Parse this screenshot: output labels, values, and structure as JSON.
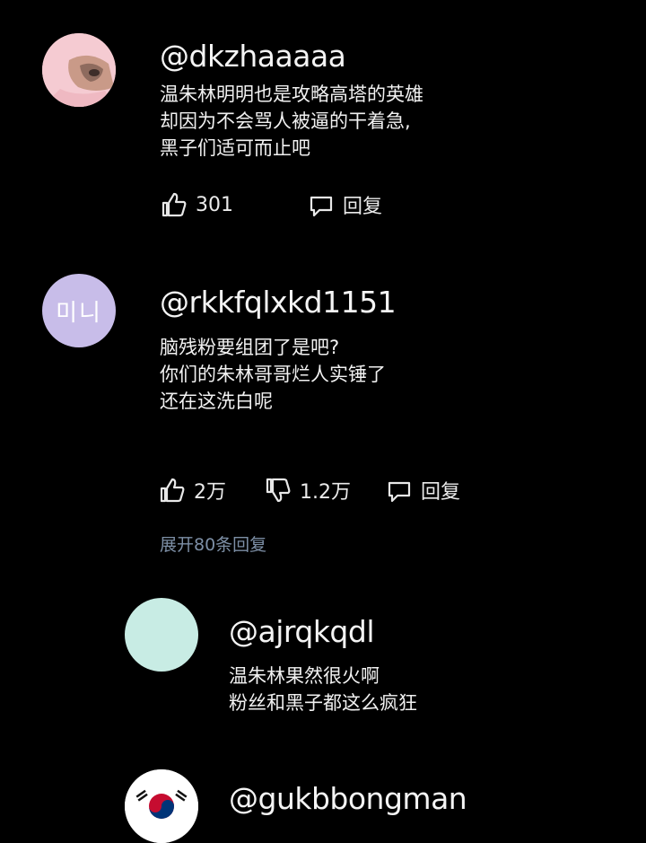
{
  "comments": [
    {
      "username": "@dkzhaaaaa",
      "text": [
        "温朱林明明也是攻略高塔的英雄",
        "却因为不会骂人被逼的干着急,",
        "黑子们适可而止吧"
      ],
      "likes": "301",
      "reply_label": "回复",
      "avatar_color": "#f6c5cc"
    },
    {
      "username": "@rkkfqlxkd1151",
      "text": [
        "脑残粉要组团了是吧?",
        "你们的朱林哥哥烂人实锤了",
        "还在这洗白呢"
      ],
      "likes": "2万",
      "dislikes": "1.2万",
      "reply_label": "回复",
      "expand_label": "展开80条回复",
      "avatar_text": "미니",
      "avatar_color": "#c8bde9"
    }
  ],
  "replies": [
    {
      "username": "@ajrqkqdl",
      "text": [
        "温朱林果然很火啊",
        "粉丝和黑子都这么疯狂"
      ],
      "avatar_color": "#c8ece4"
    },
    {
      "username": "@gukbbongman",
      "avatar_icon": "korea-flag-icon"
    }
  ],
  "colors": {
    "background": "#000000",
    "expand_link": "#7d8fa6"
  }
}
